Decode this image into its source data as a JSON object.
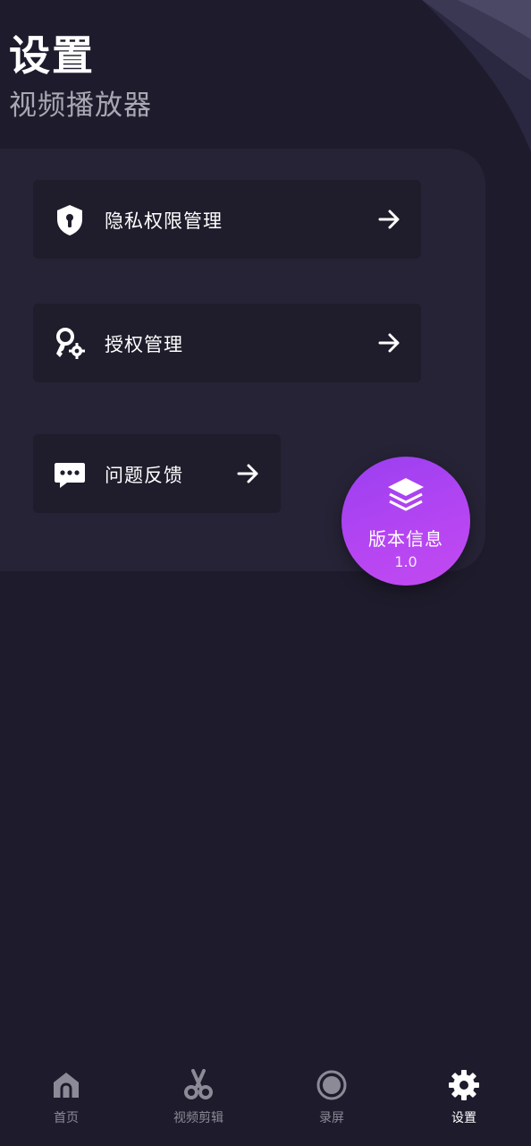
{
  "header": {
    "title": "设置",
    "subtitle": "视频播放器"
  },
  "settings": {
    "items": [
      {
        "label": "隐私权限管理",
        "icon": "shield-lock-icon"
      },
      {
        "label": "授权管理",
        "icon": "key-gear-icon"
      },
      {
        "label": "问题反馈",
        "icon": "chat-bubble-icon"
      }
    ]
  },
  "version": {
    "label": "版本信息",
    "number": "1.0",
    "icon": "layers-icon"
  },
  "tabbar": {
    "active": "设置",
    "tabs": [
      {
        "label": "首页",
        "icon": "home-icon"
      },
      {
        "label": "视频剪辑",
        "icon": "scissors-icon"
      },
      {
        "label": "录屏",
        "icon": "record-icon"
      },
      {
        "label": "设置",
        "icon": "gear-icon"
      }
    ]
  },
  "colors": {
    "background": "#1e1b2c",
    "panel": "#262336",
    "row": "#1f1c2b",
    "accent_start": "#9a3ff0",
    "accent_end": "#c24af0",
    "tab_inactive": "#8d8a98"
  }
}
